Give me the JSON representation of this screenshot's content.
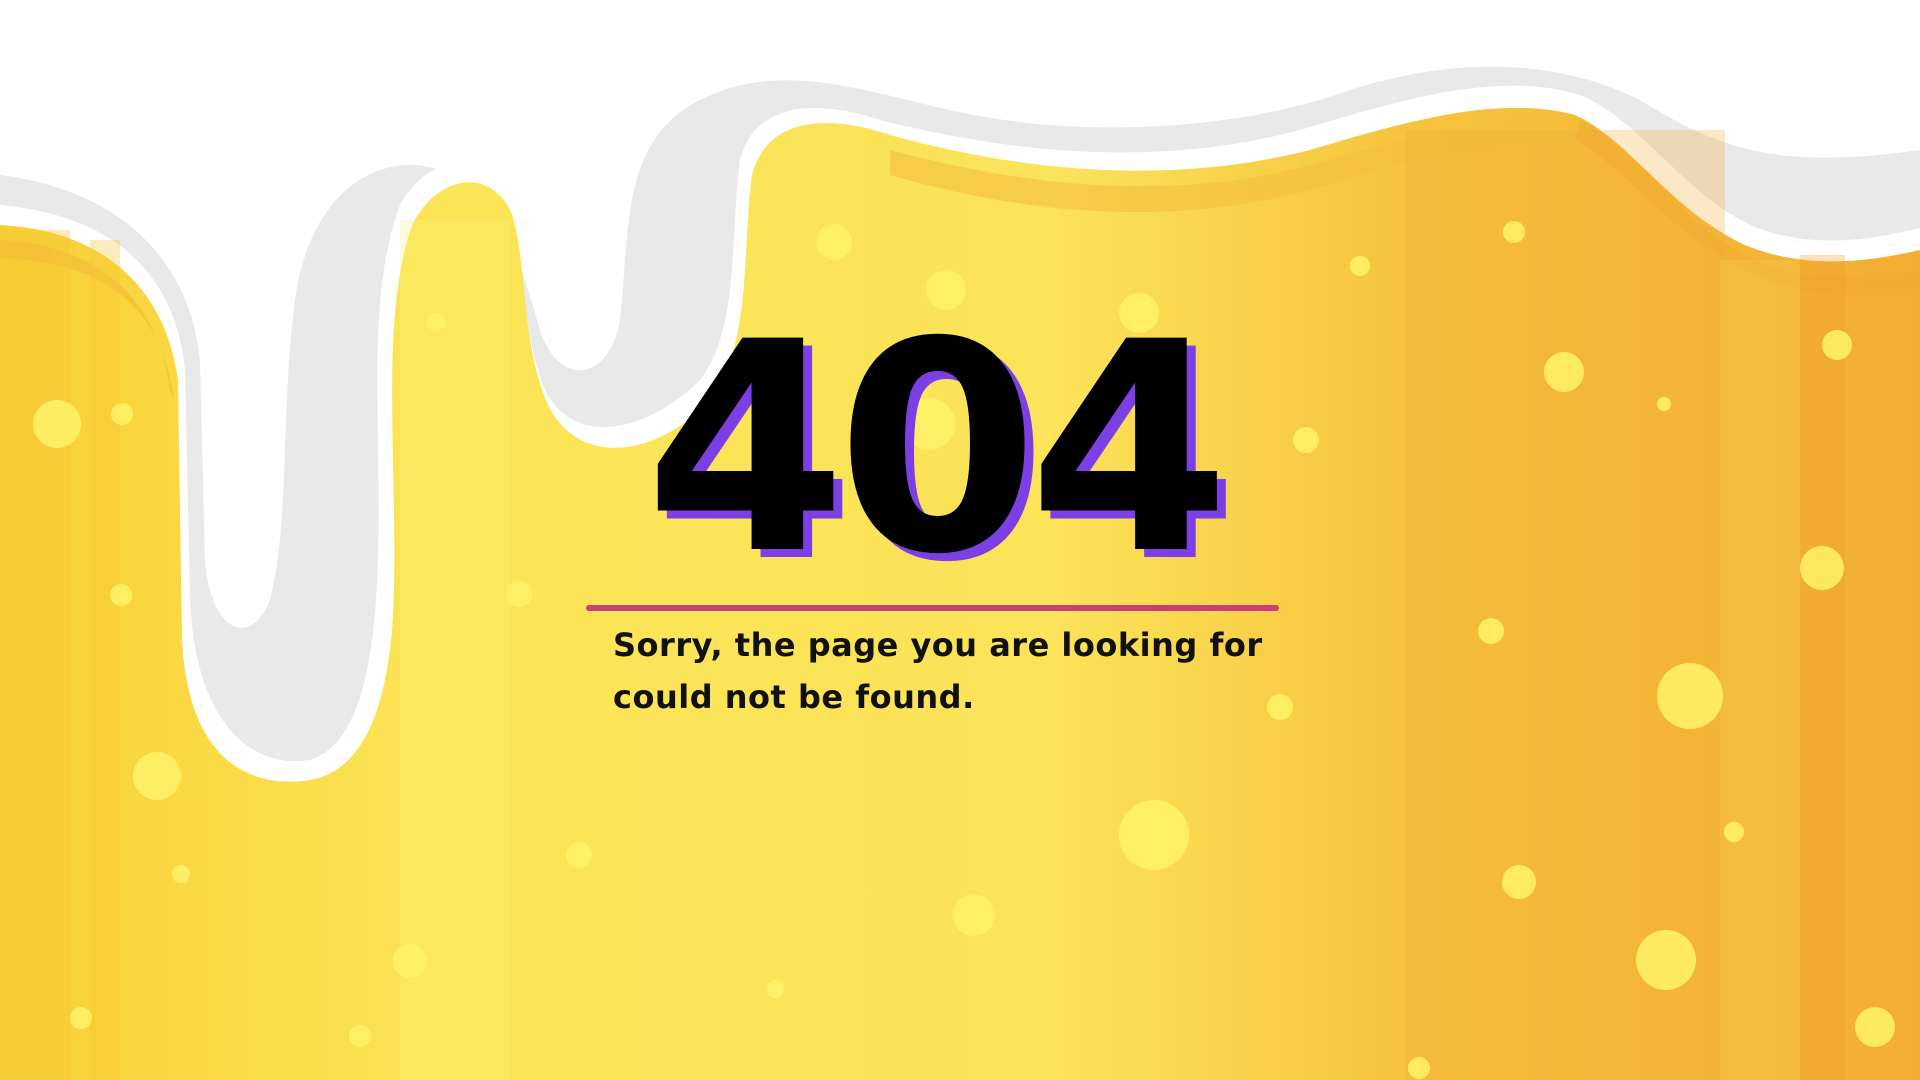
{
  "page": {
    "error_code": "404",
    "message": "Sorry, the page you are looking for could not be found."
  },
  "colors": {
    "background": "#ffffff",
    "honey_light": "#fbe45a",
    "honey_mid": "#f7c93c",
    "honey_dark": "#f2a632",
    "bubble": "#fff36a",
    "drip_shadow": "#e6e6e6",
    "code_text": "#000000",
    "code_shadow": "#7b3fe4",
    "divider": "#c7407a",
    "message_text": "#111111"
  },
  "icons": {
    "background": "honey-drip-illustration"
  }
}
